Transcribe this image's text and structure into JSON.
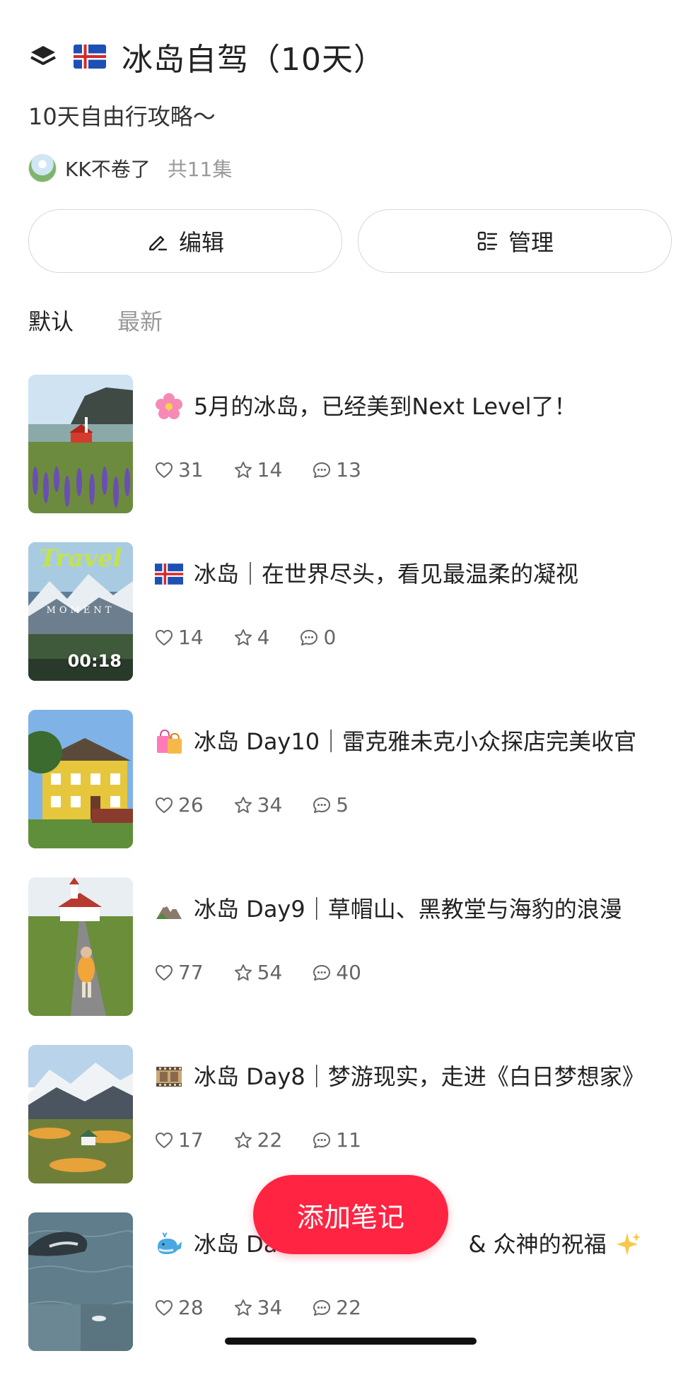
{
  "header": {
    "title": "冰岛自驾（10天）",
    "subtitle": "10天自由行攻略～",
    "author": "KK不卷了",
    "episode_count": "共11集",
    "icons": [
      "layers-icon",
      "iceland-flag"
    ]
  },
  "buttons": {
    "edit_label": "编辑",
    "manage_label": "管理"
  },
  "tabs": {
    "default_label": "默认",
    "latest_label": "最新"
  },
  "notes": [
    {
      "emoji": "cherry-blossom",
      "title": "5月的冰岛，已经美到Next Level了！",
      "likes": "31",
      "stars": "14",
      "comments": "13"
    },
    {
      "emoji": "iceland-flag",
      "title": "冰岛｜在世界尽头，看见最温柔的凝视",
      "likes": "14",
      "stars": "4",
      "comments": "0",
      "duration": "00:18",
      "thumb_text": "Travel"
    },
    {
      "emoji": "shopping-bags",
      "title": "冰岛 Day10｜雷克雅未克小众探店完美收官",
      "likes": "26",
      "stars": "34",
      "comments": "5"
    },
    {
      "emoji": "mountain",
      "title": "冰岛 Day9｜草帽山、黑教堂与海豹的浪漫",
      "likes": "77",
      "stars": "54",
      "comments": "40"
    },
    {
      "emoji": "film-frames",
      "title": "冰岛 Day8｜梦游现实，走进《白日梦想家》",
      "likes": "17",
      "stars": "22",
      "comments": "11"
    },
    {
      "emoji": "whale",
      "title": "冰岛 Da",
      "title_tail": "& 众神的祝福",
      "likes": "28",
      "stars": "34",
      "comments": "22"
    }
  ],
  "fab_label": "添加笔记",
  "colors": {
    "accent": "#ff2442",
    "text_primary": "#222222",
    "text_secondary": "#999999",
    "border": "#d7d7d7"
  }
}
